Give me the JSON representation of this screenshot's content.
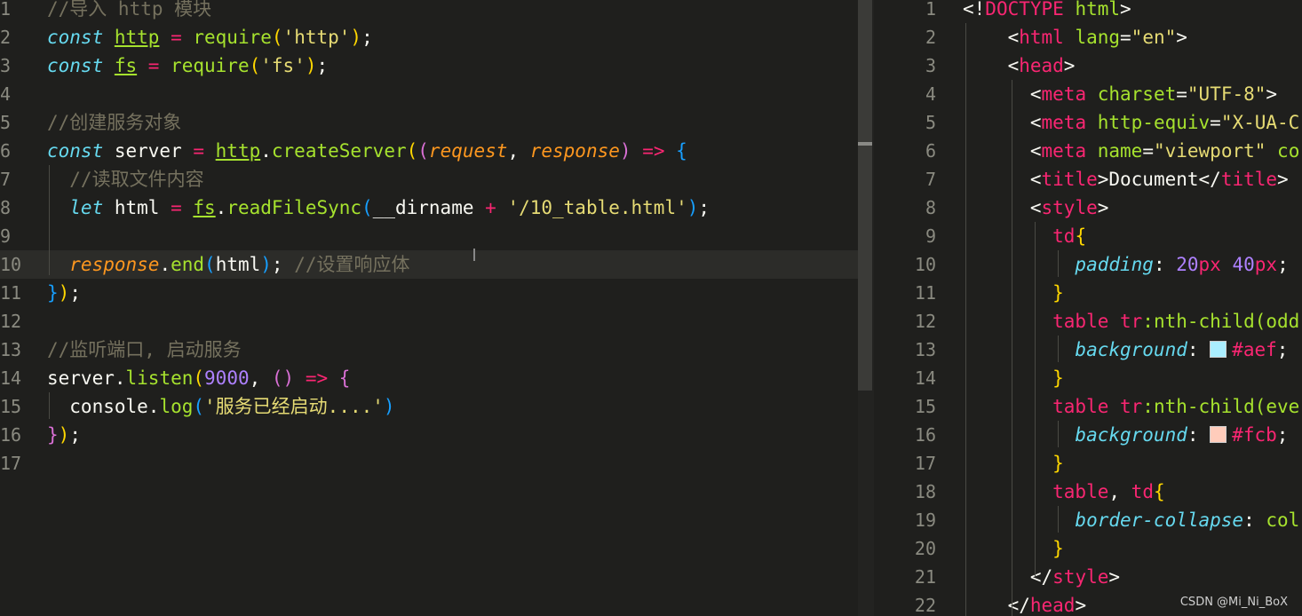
{
  "left_editor": {
    "lines": [
      {
        "n": "1",
        "segs": [
          [
            "c-comment",
            "//导入 http 模块"
          ]
        ]
      },
      {
        "n": "2",
        "segs": [
          [
            "c-kw",
            "const "
          ],
          [
            "c-var u",
            "http"
          ],
          [
            "c-op",
            " = "
          ],
          [
            "c-fn",
            "require"
          ],
          [
            "c-p1",
            "("
          ],
          [
            "c-str",
            "'http'"
          ],
          [
            "c-p1",
            ")"
          ],
          [
            "c-white",
            ";"
          ]
        ]
      },
      {
        "n": "3",
        "segs": [
          [
            "c-kw",
            "const "
          ],
          [
            "c-var u",
            "fs"
          ],
          [
            "c-op",
            " = "
          ],
          [
            "c-fn",
            "require"
          ],
          [
            "c-p1",
            "("
          ],
          [
            "c-str",
            "'fs'"
          ],
          [
            "c-p1",
            ")"
          ],
          [
            "c-white",
            ";"
          ]
        ]
      },
      {
        "n": "4",
        "segs": []
      },
      {
        "n": "5",
        "segs": [
          [
            "c-comment",
            "//创建服务对象"
          ]
        ]
      },
      {
        "n": "6",
        "segs": [
          [
            "c-kw",
            "const "
          ],
          [
            "c-white",
            "server"
          ],
          [
            "c-op",
            " = "
          ],
          [
            "c-var u",
            "http"
          ],
          [
            "c-white",
            "."
          ],
          [
            "c-fn",
            "createServer"
          ],
          [
            "c-p1",
            "("
          ],
          [
            "c-p2",
            "("
          ],
          [
            "c-param",
            "request"
          ],
          [
            "c-white",
            ", "
          ],
          [
            "c-param",
            "response"
          ],
          [
            "c-p2",
            ")"
          ],
          [
            "c-op",
            " => "
          ],
          [
            "c-p3",
            "{"
          ]
        ]
      },
      {
        "n": "7",
        "segs": [
          [
            "c-comment",
            "  //读取文件内容"
          ]
        ]
      },
      {
        "n": "8",
        "segs": [
          [
            "c-kw",
            "  let "
          ],
          [
            "c-white",
            "html"
          ],
          [
            "c-op",
            " = "
          ],
          [
            "c-var u",
            "fs"
          ],
          [
            "c-white",
            "."
          ],
          [
            "c-fn",
            "readFileSync"
          ],
          [
            "c-p3",
            "("
          ],
          [
            "c-white",
            "__dirname"
          ],
          [
            "c-op",
            " + "
          ],
          [
            "c-str",
            "'/10_table.html'"
          ],
          [
            "c-p3",
            ")"
          ],
          [
            "c-white",
            ";"
          ]
        ]
      },
      {
        "n": "9",
        "segs": []
      },
      {
        "n": "10",
        "segs": [
          [
            "c-param",
            "  response"
          ],
          [
            "c-white",
            "."
          ],
          [
            "c-fn",
            "end"
          ],
          [
            "c-p3",
            "("
          ],
          [
            "c-white",
            "html"
          ],
          [
            "c-p3",
            ")"
          ],
          [
            "c-white",
            "; "
          ],
          [
            "c-comment",
            "//设置响应体"
          ]
        ]
      },
      {
        "n": "11",
        "segs": [
          [
            "c-p3",
            "}"
          ],
          [
            "c-p1",
            ")"
          ],
          [
            "c-white",
            ";"
          ]
        ]
      },
      {
        "n": "12",
        "segs": []
      },
      {
        "n": "13",
        "segs": [
          [
            "c-comment",
            "//监听端口, 启动服务"
          ]
        ]
      },
      {
        "n": "14",
        "segs": [
          [
            "c-white",
            "server."
          ],
          [
            "c-fn",
            "listen"
          ],
          [
            "c-p1",
            "("
          ],
          [
            "c-num",
            "9000"
          ],
          [
            "c-white",
            ", "
          ],
          [
            "c-p2",
            "()"
          ],
          [
            "c-op",
            " => "
          ],
          [
            "c-p2",
            "{"
          ]
        ]
      },
      {
        "n": "15",
        "segs": [
          [
            "c-white",
            "  console."
          ],
          [
            "c-fn",
            "log"
          ],
          [
            "c-p3",
            "("
          ],
          [
            "c-str",
            "'服务已经启动....'"
          ],
          [
            "c-p3",
            ")"
          ]
        ]
      },
      {
        "n": "16",
        "segs": [
          [
            "c-p2",
            "}"
          ],
          [
            "c-p1",
            ")"
          ],
          [
            "c-white",
            ";"
          ]
        ]
      },
      {
        "n": "17",
        "segs": []
      }
    ]
  },
  "right_editor": {
    "lines": [
      {
        "n": "1",
        "segs": [
          [
            "c-white",
            "<!"
          ],
          [
            "c-tag",
            "DOCTYPE"
          ],
          [
            "c-attr",
            " html"
          ],
          [
            "c-white",
            ">"
          ]
        ]
      },
      {
        "n": "2",
        "segs": [
          [
            "c-white",
            "    <"
          ],
          [
            "c-tag",
            "html"
          ],
          [
            "c-attr",
            " lang"
          ],
          [
            "c-white",
            "="
          ],
          [
            "c-str",
            "\"en\""
          ],
          [
            "c-white",
            ">"
          ]
        ]
      },
      {
        "n": "3",
        "segs": [
          [
            "c-white",
            "    <"
          ],
          [
            "c-tag",
            "head"
          ],
          [
            "c-white",
            ">"
          ]
        ]
      },
      {
        "n": "4",
        "segs": [
          [
            "c-white",
            "      <"
          ],
          [
            "c-tag",
            "meta"
          ],
          [
            "c-attr",
            " charset"
          ],
          [
            "c-white",
            "="
          ],
          [
            "c-str",
            "\"UTF-8\""
          ],
          [
            "c-white",
            ">"
          ]
        ]
      },
      {
        "n": "5",
        "segs": [
          [
            "c-white",
            "      <"
          ],
          [
            "c-tag",
            "meta"
          ],
          [
            "c-attr",
            " http-equiv"
          ],
          [
            "c-white",
            "="
          ],
          [
            "c-str",
            "\"X-UA-C"
          ]
        ]
      },
      {
        "n": "6",
        "segs": [
          [
            "c-white",
            "      <"
          ],
          [
            "c-tag",
            "meta"
          ],
          [
            "c-attr",
            " name"
          ],
          [
            "c-white",
            "="
          ],
          [
            "c-str",
            "\"viewport\""
          ],
          [
            "c-attr",
            " co"
          ]
        ]
      },
      {
        "n": "7",
        "segs": [
          [
            "c-white",
            "      <"
          ],
          [
            "c-tag",
            "title"
          ],
          [
            "c-white",
            ">Document</"
          ],
          [
            "c-tag",
            "title"
          ],
          [
            "c-white",
            ">"
          ]
        ]
      },
      {
        "n": "8",
        "segs": [
          [
            "c-white",
            "      <"
          ],
          [
            "c-tag",
            "style"
          ],
          [
            "c-white",
            ">"
          ]
        ]
      },
      {
        "n": "9",
        "segs": [
          [
            "c-tag",
            "        td"
          ],
          [
            "c-p1",
            "{"
          ]
        ]
      },
      {
        "n": "10",
        "segs": [
          [
            "c-prop",
            "          padding"
          ],
          [
            "c-white",
            ": "
          ],
          [
            "c-num",
            "20"
          ],
          [
            "c-tag",
            "px "
          ],
          [
            "c-num",
            "40"
          ],
          [
            "c-tag",
            "px"
          ],
          [
            "c-white",
            ";"
          ]
        ]
      },
      {
        "n": "11",
        "segs": [
          [
            "c-p1",
            "        }"
          ]
        ]
      },
      {
        "n": "12",
        "segs": [
          [
            "c-tag",
            "        table tr"
          ],
          [
            "c-attr",
            ":nth-child(odd"
          ]
        ]
      },
      {
        "n": "13",
        "segs": [
          [
            "c-prop",
            "          background"
          ],
          [
            "c-white",
            ": "
          ],
          [
            "swatch-aef",
            ""
          ],
          [
            "c-tag",
            "#aef"
          ],
          [
            "c-white",
            ";"
          ]
        ]
      },
      {
        "n": "14",
        "segs": [
          [
            "c-p1",
            "        }"
          ]
        ]
      },
      {
        "n": "15",
        "segs": [
          [
            "c-tag",
            "        table tr"
          ],
          [
            "c-attr",
            ":nth-child(eve"
          ]
        ]
      },
      {
        "n": "16",
        "segs": [
          [
            "c-prop",
            "          background"
          ],
          [
            "c-white",
            ": "
          ],
          [
            "swatch-fcb",
            ""
          ],
          [
            "c-tag",
            "#fcb"
          ],
          [
            "c-white",
            ";"
          ]
        ]
      },
      {
        "n": "17",
        "segs": [
          [
            "c-p1",
            "        }"
          ]
        ]
      },
      {
        "n": "18",
        "segs": [
          [
            "c-tag",
            "        table"
          ],
          [
            "c-white",
            ", "
          ],
          [
            "c-tag",
            "td"
          ],
          [
            "c-p1",
            "{"
          ]
        ]
      },
      {
        "n": "19",
        "segs": [
          [
            "c-prop",
            "          border-collapse"
          ],
          [
            "c-white",
            ": "
          ],
          [
            "c-attr",
            "col"
          ]
        ]
      },
      {
        "n": "20",
        "segs": [
          [
            "c-p1",
            "        }"
          ]
        ]
      },
      {
        "n": "21",
        "segs": [
          [
            "c-white",
            "      </"
          ],
          [
            "c-tag",
            "style"
          ],
          [
            "c-white",
            ">"
          ]
        ]
      },
      {
        "n": "22",
        "segs": [
          [
            "c-white",
            "    </"
          ],
          [
            "c-tag",
            "head"
          ],
          [
            "c-white",
            ">"
          ]
        ]
      }
    ]
  },
  "watermark": "CSDN @Mi_Ni_BoX",
  "colors": {
    "swatch_aef": "#aaeeff",
    "swatch_fcb": "#ffccbb",
    "background": "#1f1f1d"
  }
}
